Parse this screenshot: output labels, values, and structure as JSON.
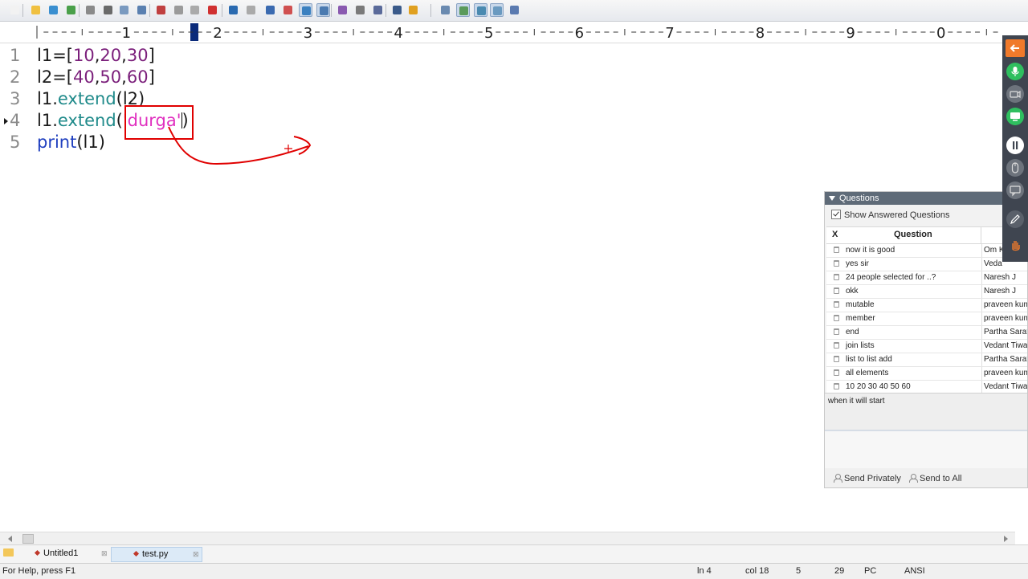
{
  "ruler": {
    "labels": [
      "1",
      "2",
      "3",
      "4",
      "5",
      "6",
      "7",
      "8",
      "9",
      "0"
    ]
  },
  "editor": {
    "lines": [
      {
        "num": "1",
        "parts": [
          {
            "t": "l1=[",
            "c": ""
          },
          {
            "t": "10",
            "c": "n"
          },
          {
            "t": ",",
            "c": ""
          },
          {
            "t": "20",
            "c": "n"
          },
          {
            "t": ",",
            "c": ""
          },
          {
            "t": "30",
            "c": "n"
          },
          {
            "t": "]",
            "c": ""
          }
        ]
      },
      {
        "num": "2",
        "parts": [
          {
            "t": "l2=[",
            "c": ""
          },
          {
            "t": "40",
            "c": "n"
          },
          {
            "t": ",",
            "c": ""
          },
          {
            "t": "50",
            "c": "n"
          },
          {
            "t": ",",
            "c": ""
          },
          {
            "t": "60",
            "c": "n"
          },
          {
            "t": "]",
            "c": ""
          }
        ]
      },
      {
        "num": "3",
        "parts": [
          {
            "t": "l1.",
            "c": ""
          },
          {
            "t": "extend",
            "c": "f"
          },
          {
            "t": "(l2)",
            "c": ""
          }
        ]
      },
      {
        "num": "4",
        "parts": [
          {
            "t": "l1.",
            "c": ""
          },
          {
            "t": "extend",
            "c": "f"
          },
          {
            "t": "(",
            "c": ""
          },
          {
            "t": "'durga'",
            "c": "s"
          },
          {
            "t": ")",
            "c": ""
          }
        ]
      },
      {
        "num": "5",
        "parts": [
          {
            "t": "print",
            "c": "k"
          },
          {
            "t": "(l1)",
            "c": ""
          }
        ]
      }
    ]
  },
  "questions": {
    "title": "Questions",
    "show_answered_label": "Show Answered Questions",
    "col_x": "X",
    "col_question": "Question",
    "rows": [
      {
        "q": "now it is good",
        "a": "Om K"
      },
      {
        "q": "yes sir",
        "a": "Veda"
      },
      {
        "q": "24 people selected for ..?",
        "a": "Naresh J"
      },
      {
        "q": "okk",
        "a": "Naresh J"
      },
      {
        "q": "mutable",
        "a": "praveen kum"
      },
      {
        "q": "member",
        "a": "praveen kum"
      },
      {
        "q": "end",
        "a": "Partha Sarat"
      },
      {
        "q": "join lists",
        "a": "Vedant Tiwa"
      },
      {
        "q": "list to list add",
        "a": "Partha Sarat"
      },
      {
        "q": "all elements",
        "a": "praveen kum"
      },
      {
        "q": "10 20 30 40 50 60",
        "a": "Vedant Tiwa"
      }
    ],
    "input_text": "when it will start",
    "send_privately": "Send Privately",
    "send_all": "Send to All"
  },
  "tabs": [
    {
      "label": "Untitled1"
    },
    {
      "label": "test.py"
    }
  ],
  "status": {
    "help": "For Help, press F1",
    "ln": "ln 4",
    "col": "col 18",
    "v1": "5",
    "v2": "29",
    "mode": "PC",
    "enc": "ANSI"
  },
  "colors": {
    "annotation": "#e00000",
    "string": "#e02fbf",
    "number": "#7b1f7b",
    "function": "#1f8a8a",
    "keyword": "#1f3fbf",
    "sidebar_orange": "#f07a2b",
    "sidebar_green": "#2fbf5f"
  },
  "icons": [
    "arrow-left-icon",
    "microphone-icon",
    "camera-icon",
    "screen-share-icon",
    "pause-icon",
    "mouse-icon",
    "chat-icon",
    "pen-icon",
    "hand-icon"
  ]
}
